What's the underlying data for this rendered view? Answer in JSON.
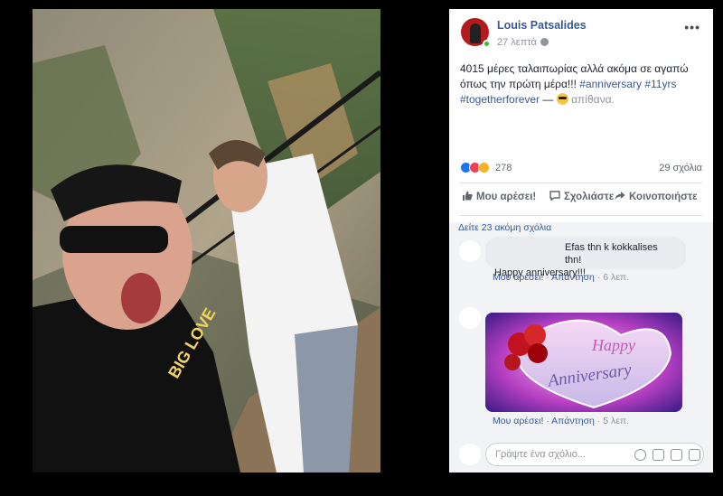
{
  "post": {
    "author": "Louis Patsalides",
    "time": "27 λεπτά",
    "privacy_icon": "globe-icon",
    "text_main": "4015 μέρες ταλαιπωρίας αλλά ακόμα σε αγαπώ όπως την πρώτη μέρα!!! ",
    "hashtag_1": "#anniversary",
    "hashtag_2": "#11yrs",
    "hashtag_3": "#togetherforever",
    "dash": " — ",
    "feeling": "απίθανα."
  },
  "reactions": {
    "count": "278",
    "comments": "29 σχόλια",
    "icons": [
      "like-icon",
      "love-icon",
      "haha-icon"
    ]
  },
  "actions": {
    "like": "Μου αρέσει!",
    "comment": "Σχολιάστε",
    "share": "Κοινοποιήστε"
  },
  "comments": {
    "view_more": "Δείτε 23 ακόμη σχόλια",
    "c1_line1": "Efas thn k kokkalises thn!",
    "c1_line2": "Happy anniversary!!!",
    "c1_like": "Μου αρέσει!",
    "c1_reply": "Απάντηση",
    "c1_time": "6 λεπ.",
    "sticker_text_1": "Happy",
    "sticker_text_2": "Anniversary",
    "c2_like": "Μου αρέσει!",
    "c2_reply": "Απάντηση",
    "c2_time": "5 λεπ.",
    "input_placeholder": "Γράψτε ένα σχόλιο...",
    "dot": "·"
  },
  "colors": {
    "link": "#385898",
    "online": "#42b72a"
  }
}
